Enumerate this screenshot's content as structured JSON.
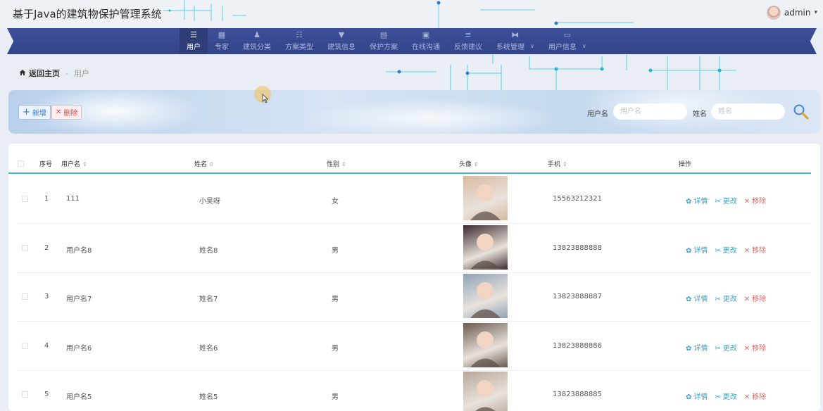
{
  "app": {
    "title": "基于Java的建筑物保护管理系统"
  },
  "user": {
    "name": "admin",
    "caret": "▾"
  },
  "nav": [
    {
      "label": "用户",
      "icon": "list-icon",
      "glyph": "☰",
      "active": true,
      "dropdown": ""
    },
    {
      "label": "专家",
      "icon": "grid-icon",
      "glyph": "▦",
      "active": false,
      "dropdown": ""
    },
    {
      "label": "建筑分类",
      "icon": "person-icon",
      "glyph": "♟",
      "active": false,
      "dropdown": ""
    },
    {
      "label": "方案类型",
      "icon": "sliders-icon",
      "glyph": "☷",
      "active": false,
      "dropdown": ""
    },
    {
      "label": "建筑信息",
      "icon": "pin-icon",
      "glyph": "▼",
      "active": false,
      "dropdown": ""
    },
    {
      "label": "保护方案",
      "icon": "clipboard-icon",
      "glyph": "▤",
      "active": false,
      "dropdown": ""
    },
    {
      "label": "在线沟通",
      "icon": "chat-icon",
      "glyph": "▣",
      "active": false,
      "dropdown": ""
    },
    {
      "label": "反馈建议",
      "icon": "menu-icon",
      "glyph": "≡",
      "active": false,
      "dropdown": ""
    },
    {
      "label": "系统管理",
      "icon": "bowtie-icon",
      "glyph": "⧓",
      "active": false,
      "dropdown": "∨"
    },
    {
      "label": "用户信息",
      "icon": "window-icon",
      "glyph": "▭",
      "active": false,
      "dropdown": "∨"
    }
  ],
  "breadcrumb": {
    "home": "返回主页",
    "sep": "-",
    "current": "用户"
  },
  "toolbar": {
    "add_label": "新增",
    "add_icon": "+",
    "delete_label": "删除",
    "delete_icon": "✕",
    "search_fields": [
      {
        "label": "用户名",
        "placeholder": "用户名"
      },
      {
        "label": "姓名",
        "placeholder": "姓名"
      }
    ]
  },
  "table": {
    "sort_glyph": "⇕",
    "columns": [
      "序号",
      "用户名",
      "姓名",
      "性别",
      "头像",
      "手机",
      "操作"
    ],
    "rows": [
      {
        "index": "1",
        "username": "111",
        "name": "小吴呀",
        "gender": "女",
        "phone": "15563212321",
        "photo": "#d9b9a0"
      },
      {
        "index": "2",
        "username": "用户名8",
        "name": "姓名8",
        "gender": "男",
        "phone": "13823888888",
        "photo": "#3b2a2e"
      },
      {
        "index": "3",
        "username": "用户名7",
        "name": "姓名7",
        "gender": "男",
        "phone": "13823888887",
        "photo": "#8fa3b8"
      },
      {
        "index": "4",
        "username": "用户名6",
        "name": "姓名6",
        "gender": "男",
        "phone": "13823888886",
        "photo": "#6b5a4e"
      },
      {
        "index": "5",
        "username": "用户名5",
        "name": "姓名5",
        "gender": "男",
        "phone": "13823888885",
        "photo": "#b8a89a"
      }
    ],
    "actions": {
      "view": "详情",
      "view_icon": "✿",
      "edit": "更改",
      "edit_icon": "✂",
      "delete": "移除",
      "delete_icon": "✕"
    }
  }
}
